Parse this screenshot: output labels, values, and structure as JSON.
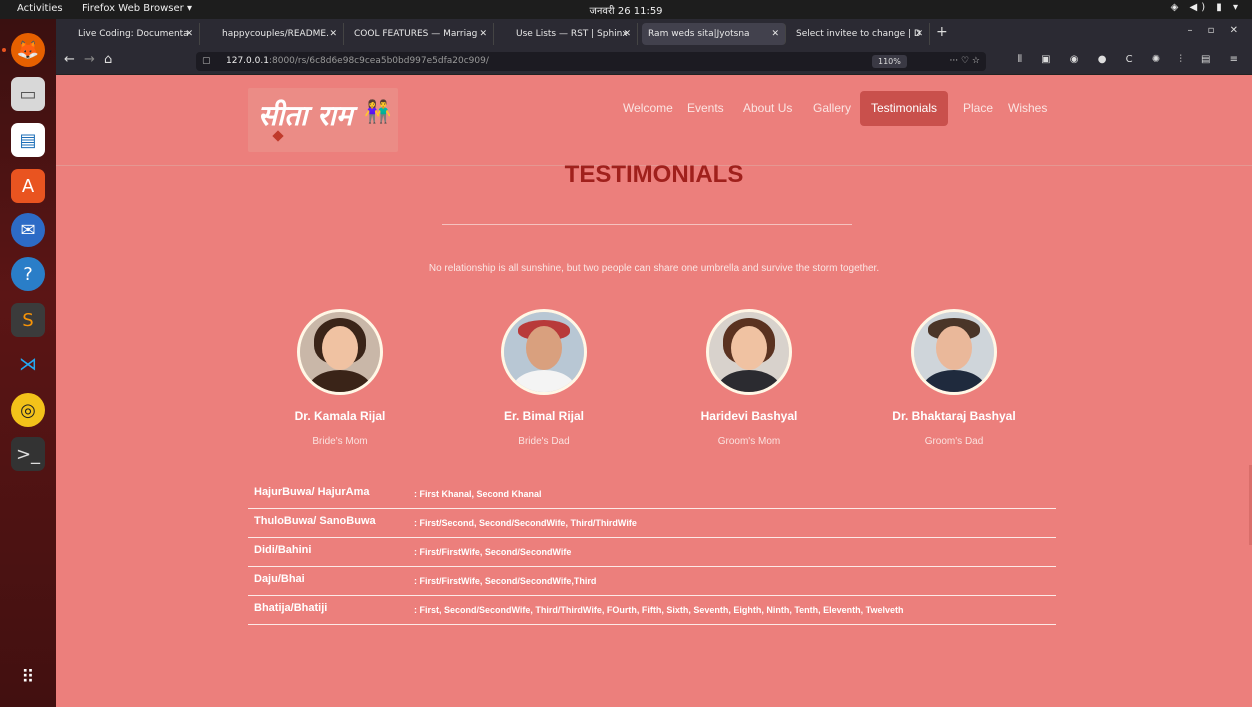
{
  "topbar": {
    "activities": "Activities",
    "app": "Firefox Web Browser ▾",
    "clock": "जनवरी 26  11:59",
    "systray": "◈ ◀) ▮ ▾"
  },
  "dock": {
    "items": [
      "firefox-icon",
      "files-icon",
      "writer-icon",
      "software-icon",
      "thunderbird-icon",
      "help-icon",
      "sublime-icon",
      "vscode-icon",
      "rhythmbox-icon",
      "terminal-icon"
    ],
    "apps_grid": "⠿"
  },
  "browser": {
    "tabs": [
      {
        "label": "Live Coding: Documenta",
        "close": "✕"
      },
      {
        "label": "happycouples/README.",
        "close": "✕"
      },
      {
        "label": "COOL FEATURES — Marriag",
        "close": "✕"
      },
      {
        "label": "Use Lists — RST | Sphinx",
        "close": "✕"
      },
      {
        "label": "Ram weds sita|Jyotsna",
        "close": "✕"
      },
      {
        "label": "Select invitee to change | D",
        "close": "✕"
      }
    ],
    "new_tab": "+",
    "window_controls": "– ▫ ✕",
    "url_host": "127.0.0.1",
    "url_path": ":8000/rs/6c8d6e98c9cea5b0bd997e5dfa20c909/",
    "zoom": "110%",
    "url_actions": "··· ♡ ☆",
    "toolbar_icons": "⫴ ▣ ◉ ● C ✺ ⫶ ▤ ≡"
  },
  "site": {
    "logo_text": "सीता राम",
    "menu": [
      "Welcome",
      "Events",
      "About Us",
      "Gallery",
      "Testimonials",
      "Place",
      "Wishes"
    ],
    "active_menu": "Testimonials",
    "title": "TESTIMONIALS",
    "quote": "No relationship is all sunshine, but two people can share one umbrella and survive the storm together.",
    "people": [
      {
        "name": "Dr. Kamala Rijal",
        "role": "Bride's Mom"
      },
      {
        "name": "Er. Bimal Rijal",
        "role": "Bride's Dad"
      },
      {
        "name": "Haridevi Bashyal",
        "role": "Groom's Mom"
      },
      {
        "name": "Dr. Bhaktaraj Bashyal",
        "role": "Groom's Dad"
      }
    ],
    "relations": [
      {
        "key": "HajurBuwa/ HajurAma",
        "value": ": First Khanal, Second Khanal"
      },
      {
        "key": "ThuloBuwa/ SanoBuwa",
        "value": ": First/Second, Second/SecondWife, Third/ThirdWife"
      },
      {
        "key": "Didi/Bahini",
        "value": ": First/FirstWife, Second/SecondWife"
      },
      {
        "key": "Daju/Bhai",
        "value": ": First/FirstWife, Second/SecondWife,Third"
      },
      {
        "key": "Bhatija/Bhatiji",
        "value": ": First, Second/SecondWife, Third/ThirdWife, FOurth, Fifth, Sixth, Seventh, Eighth, Ninth, Tenth, Eleventh, Twelveth"
      }
    ]
  }
}
